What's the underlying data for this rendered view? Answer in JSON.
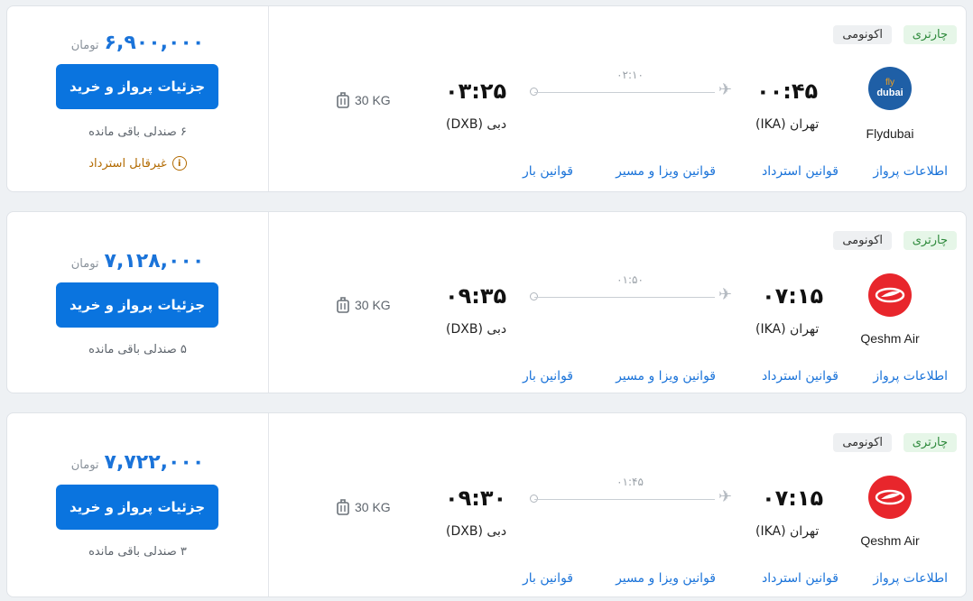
{
  "labels": {
    "currency": "تومان",
    "buy": "جزئیات پرواز و خرید",
    "class": "اکونومی",
    "charter": "چارتری",
    "link_info": "اطلاعات پرواز",
    "link_refund": "قوانین استرداد",
    "link_visa": "قوانین ویزا و مسیر",
    "link_baggage": "قوانین بار",
    "non_refundable": "غیرقابل استرداد"
  },
  "flights": [
    {
      "price": "۶,۹۰۰,۰۰۰",
      "seats": "۶ صندلی باقی مانده",
      "baggage": "30 KG",
      "dep_time": "۰۰:۴۵",
      "arr_time": "۰۳:۲۵",
      "duration": "۰۲:۱۰",
      "dep_city": "تهران (IKA)",
      "arr_city": "دبی (DXB)",
      "airline": "Flydubai",
      "refundable": false
    },
    {
      "price": "۷,۱۲۸,۰۰۰",
      "seats": "۵ صندلی باقی مانده",
      "baggage": "30 KG",
      "dep_time": "۰۷:۱۵",
      "arr_time": "۰۹:۳۵",
      "duration": "۰۱:۵۰",
      "dep_city": "تهران (IKA)",
      "arr_city": "دبی (DXB)",
      "airline": "Qeshm Air",
      "refundable": true
    },
    {
      "price": "۷,۷۲۲,۰۰۰",
      "seats": "۳ صندلی باقی مانده",
      "baggage": "30 KG",
      "dep_time": "۰۷:۱۵",
      "arr_time": "۰۹:۳۰",
      "duration": "۰۱:۴۵",
      "dep_city": "تهران (IKA)",
      "arr_city": "دبی (DXB)",
      "airline": "Qeshm Air",
      "refundable": true
    }
  ],
  "logos": {
    "flydubai_top": "fly",
    "flydubai_bottom": "dubai"
  },
  "colors": {
    "accent": "#0a74df",
    "price": "#1a73d9",
    "charter_bg": "#e6f6e8",
    "charter_text": "#2e8a3c",
    "qeshm_red": "#e8262c",
    "flydubai_blue": "#1f5fa6"
  }
}
